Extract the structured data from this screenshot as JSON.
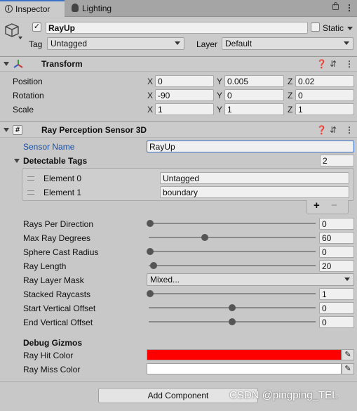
{
  "tabs": [
    {
      "label": "Inspector",
      "active": true
    },
    {
      "label": "Lighting",
      "active": false
    }
  ],
  "object": {
    "name": "RayUp",
    "static_label": "Static",
    "tag_label": "Tag",
    "tag_value": "Untagged",
    "layer_label": "Layer",
    "layer_value": "Default"
  },
  "transform": {
    "title": "Transform",
    "rows": [
      {
        "label": "Position",
        "x": "0",
        "y": "0.005",
        "z": "0.02"
      },
      {
        "label": "Rotation",
        "x": "-90",
        "y": "0",
        "z": "0"
      },
      {
        "label": "Scale",
        "x": "1",
        "y": "1",
        "z": "1"
      }
    ],
    "axis_x": "X",
    "axis_y": "Y",
    "axis_z": "Z"
  },
  "sensor": {
    "title": "Ray Perception Sensor 3D",
    "icon_glyph": "#",
    "sensor_name_label": "Sensor Name",
    "sensor_name_value": "RayUp",
    "detectable_tags_label": "Detectable Tags",
    "detectable_tags_count": "2",
    "elements": [
      {
        "label": "Element 0",
        "value": "Untagged"
      },
      {
        "label": "Element 1",
        "value": "boundary"
      }
    ],
    "add_glyph": "+",
    "remove_glyph": "−",
    "sliders": [
      {
        "label": "Rays Per Direction",
        "value": "0",
        "fraction": 0.0
      },
      {
        "label": "Max Ray Degrees",
        "value": "60",
        "fraction": 0.333
      },
      {
        "label": "Sphere Cast Radius",
        "value": "0",
        "fraction": 0.0
      },
      {
        "label": "Ray Length",
        "value": "20",
        "fraction": 0.02
      },
      {
        "label": "Ray Layer Mask",
        "dropdown": "Mixed..."
      },
      {
        "label": "Stacked Raycasts",
        "value": "1",
        "fraction": 0.0
      },
      {
        "label": "Start Vertical Offset",
        "value": "0",
        "fraction": 0.5
      },
      {
        "label": "End Vertical Offset",
        "value": "0",
        "fraction": 0.5
      }
    ],
    "debug_label": "Debug Gizmos",
    "hit_color_label": "Ray Hit Color",
    "hit_color": "#ff0000",
    "miss_color_label": "Ray Miss Color",
    "miss_color": "#ffffff"
  },
  "add_component_label": "Add Component",
  "watermark": "CSDN @pingping_TEL",
  "colors": {
    "accent_link": "#1a4fa0",
    "focus_border": "#3a72c8"
  }
}
